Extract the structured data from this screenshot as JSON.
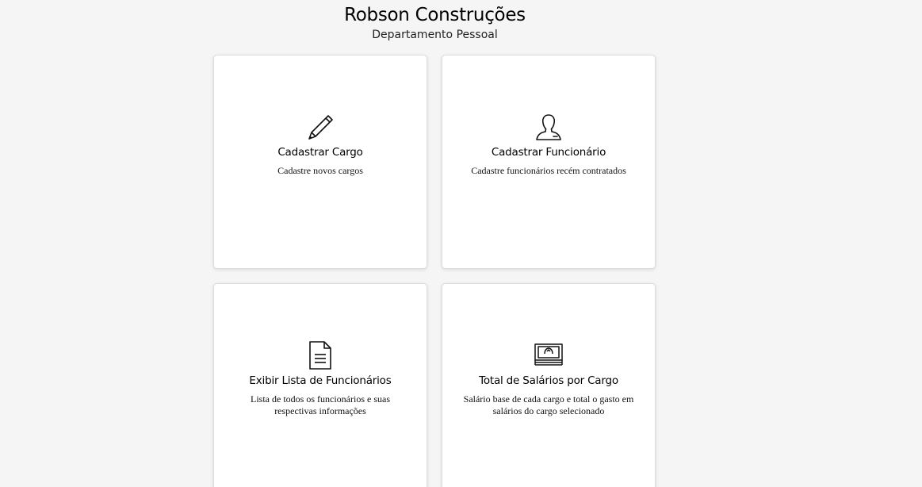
{
  "header": {
    "title": "Robson Construções",
    "subtitle": "Departamento Pessoal"
  },
  "cards": [
    {
      "icon": "pencil-icon",
      "title": "Cadastrar Cargo",
      "description": "Cadastre novos cargos"
    },
    {
      "icon": "user-icon",
      "title": "Cadastrar Funcionário",
      "description": "Cadastre funcionários recém contratados"
    },
    {
      "icon": "document-icon",
      "title": "Exibir Lista de Funcionários",
      "description": "Lista de todos os funcionários e suas respectivas informações"
    },
    {
      "icon": "money-icon",
      "title": "Total de Salários por Cargo",
      "description": "Salário base de cada cargo e total o gasto em salários do cargo selecionado"
    }
  ]
}
